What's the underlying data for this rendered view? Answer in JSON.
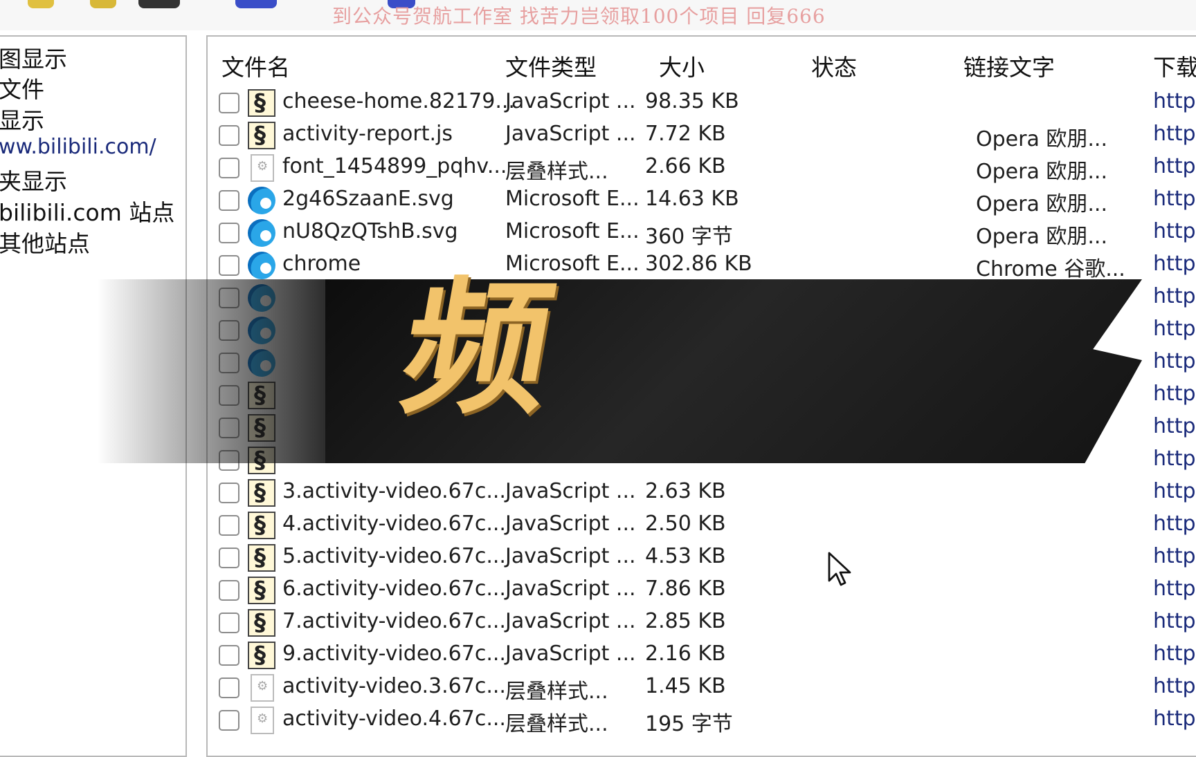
{
  "watermark": "到公众号贺航工作室 找苦力岂领取100个项目 回复666",
  "tree": {
    "items": [
      "图显示",
      "文件",
      "显示",
      "ww.bilibili.com/",
      "夹显示",
      "bilibili.com 站点",
      "其他站点"
    ]
  },
  "columns": [
    "文件名",
    "文件类型",
    "大小",
    "状态",
    "链接文字",
    "下载"
  ],
  "rows": [
    {
      "name": "cheese-home.82179...",
      "type": "JavaScript ...",
      "size": "98.35 KB",
      "link": "",
      "dl": "https",
      "icon": "js-file-icon"
    },
    {
      "name": "activity-report.js",
      "type": "JavaScript ...",
      "size": "7.72 KB",
      "link": "Opera 欧朋...",
      "dl": "https",
      "icon": "js-file-icon"
    },
    {
      "name": "font_1454899_pqhv...",
      "type": "层叠样式...",
      "size": "2.66 KB",
      "link": "Opera 欧朋...",
      "dl": "https",
      "icon": "css-file-icon"
    },
    {
      "name": "2g46SzaanE.svg",
      "type": "Microsoft E...",
      "size": "14.63 KB",
      "link": "Opera 欧朋...",
      "dl": "https",
      "icon": "edge-browser-icon"
    },
    {
      "name": "nU8QzQTshB.svg",
      "type": "Microsoft E...",
      "size": "360 字节",
      "link": "Opera 欧朋...",
      "dl": "https",
      "icon": "edge-browser-icon"
    },
    {
      "name": "chrome",
      "type": "Microsoft E...",
      "size": "302.86 KB",
      "link": "Chrome 谷歌...",
      "dl": "https",
      "icon": "edge-browser-icon"
    },
    {
      "name": "",
      "type": "",
      "size": "",
      "link": "",
      "dl": "https",
      "icon": "edge-browser-icon"
    },
    {
      "name": "",
      "type": "",
      "size": "",
      "link": "",
      "dl": "https",
      "icon": "edge-browser-icon"
    },
    {
      "name": "",
      "type": "",
      "size": "",
      "link": "",
      "dl": "https",
      "icon": "edge-browser-icon"
    },
    {
      "name": "",
      "type": "",
      "size": "",
      "link": "",
      "dl": "https",
      "icon": "js-file-icon"
    },
    {
      "name": "",
      "type": "",
      "size": "",
      "link": "",
      "dl": "https",
      "icon": "js-file-icon"
    },
    {
      "name": "",
      "type": "",
      "size": "",
      "link": "",
      "dl": "https",
      "icon": "js-file-icon"
    },
    {
      "name": "3.activity-video.67c...",
      "type": "JavaScript ...",
      "size": "2.63 KB",
      "link": "",
      "dl": "https",
      "icon": "js-file-icon"
    },
    {
      "name": "4.activity-video.67c...",
      "type": "JavaScript ...",
      "size": "2.50 KB",
      "link": "",
      "dl": "https",
      "icon": "js-file-icon"
    },
    {
      "name": "5.activity-video.67c...",
      "type": "JavaScript ...",
      "size": "4.53 KB",
      "link": "",
      "dl": "https",
      "icon": "js-file-icon"
    },
    {
      "name": "6.activity-video.67c...",
      "type": "JavaScript ...",
      "size": "7.86 KB",
      "link": "",
      "dl": "https",
      "icon": "js-file-icon"
    },
    {
      "name": "7.activity-video.67c...",
      "type": "JavaScript ...",
      "size": "2.85 KB",
      "link": "",
      "dl": "https",
      "icon": "js-file-icon"
    },
    {
      "name": "9.activity-video.67c...",
      "type": "JavaScript ...",
      "size": "2.16 KB",
      "link": "",
      "dl": "https",
      "icon": "js-file-icon"
    },
    {
      "name": "activity-video.3.67c...",
      "type": "层叠样式...",
      "size": "1.45 KB",
      "link": "",
      "dl": "https",
      "icon": "css-file-icon"
    },
    {
      "name": "activity-video.4.67c...",
      "type": "层叠样式...",
      "size": "195 字节",
      "link": "",
      "dl": "https",
      "icon": "css-file-icon"
    }
  ],
  "banner": {
    "glyph": "频"
  },
  "colors": {
    "watermark": "#e7a0a0",
    "banner_text": "#f2c36b",
    "banner_bg": "#141414"
  }
}
